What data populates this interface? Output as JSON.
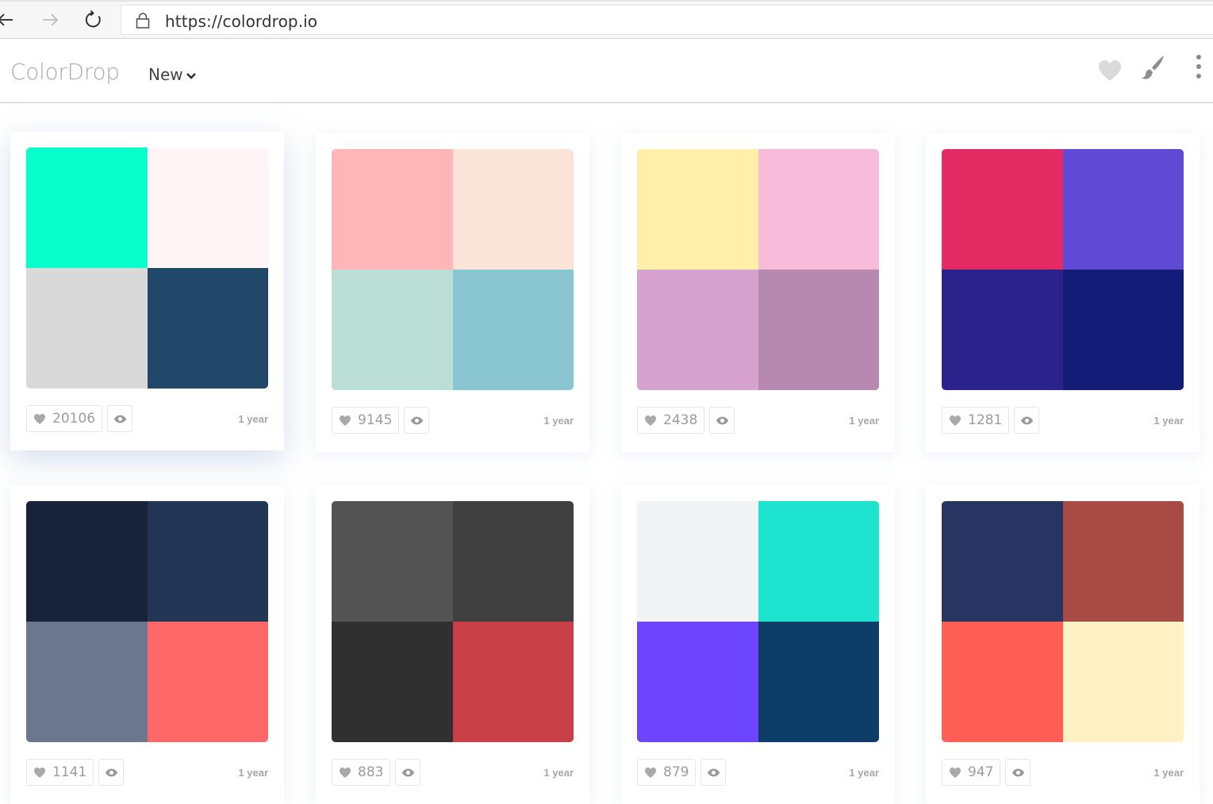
{
  "browser": {
    "url": "https://colordrop.io",
    "icons": [
      "back-arrow-icon",
      "forward-arrow-icon",
      "reload-icon",
      "lock-icon"
    ]
  },
  "header": {
    "logo": "ColorDrop",
    "sort_label": "New",
    "icons": [
      "heart-icon",
      "brush-icon",
      "more-vertical-icon"
    ]
  },
  "palettes": [
    {
      "colors": [
        "#07ffcb",
        "#fff5f6",
        "#d9d9d9",
        "#214868"
      ],
      "likes": "20106",
      "age": "1 year"
    },
    {
      "colors": [
        "#ffb6b9",
        "#fae3d9",
        "#bbded6",
        "#8ac6d1"
      ],
      "likes": "9145",
      "age": "1 year"
    },
    {
      "colors": [
        "#ffefa8",
        "#f8bcdb",
        "#d5a3ce",
        "#b789b1"
      ],
      "likes": "2438",
      "age": "1 year"
    },
    {
      "colors": [
        "#e32a63",
        "#614ad3",
        "#2c228b",
        "#131c76"
      ],
      "likes": "1281",
      "age": "1 year"
    },
    {
      "colors": [
        "#18233a",
        "#233655",
        "#6b778d",
        "#ff6768"
      ],
      "likes": "1141",
      "age": "1 year"
    },
    {
      "colors": [
        "#535353",
        "#404040",
        "#303030",
        "#c83f47"
      ],
      "likes": "883",
      "age": "1 year"
    },
    {
      "colors": [
        "#f2f3f5",
        "#1ee3cf",
        "#6d45ff",
        "#0e3e67"
      ],
      "likes": "879",
      "age": "1 year"
    },
    {
      "colors": [
        "#283461",
        "#a74b44",
        "#ff5f55",
        "#fff1c3"
      ],
      "likes": "947",
      "age": "1 year"
    }
  ]
}
